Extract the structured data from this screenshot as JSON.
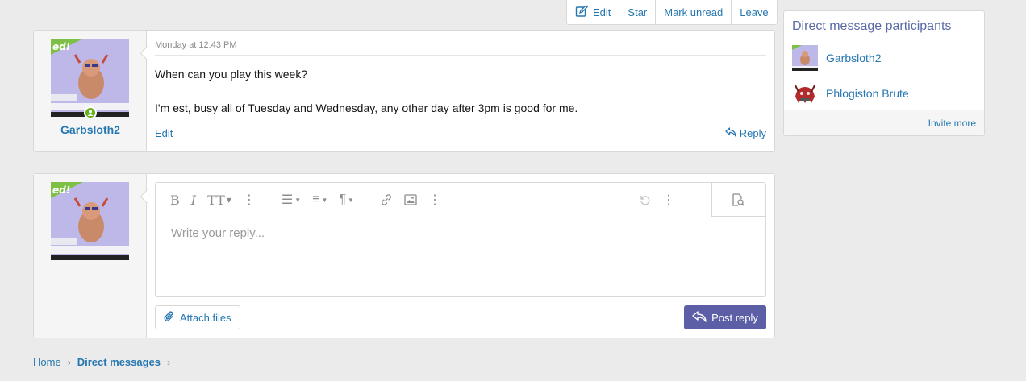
{
  "actions": {
    "edit": "Edit",
    "star": "Star",
    "mark_unread": "Mark unread",
    "leave": "Leave"
  },
  "message": {
    "author": "Garbsloth2",
    "date": "Monday at 12:43 PM",
    "paragraph1": "When can you play this week?",
    "paragraph2": "I'm est, busy all of Tuesday and Wednesday, any other day after 3pm is good for me.",
    "edit_label": "Edit",
    "reply_label": "Reply"
  },
  "reply_form": {
    "placeholder": "Write your reply...",
    "attach_label": "Attach files",
    "post_label": "Post reply"
  },
  "sidebar": {
    "title": "Direct message participants",
    "participants": [
      {
        "name": "Garbsloth2"
      },
      {
        "name": "Phlogiston Brute"
      }
    ],
    "invite_label": "Invite more"
  },
  "breadcrumb": {
    "home": "Home",
    "current": "Direct messages"
  },
  "colors": {
    "accent": "#2577b1",
    "button_primary": "#5c5ea6",
    "online": "#63b31b"
  }
}
